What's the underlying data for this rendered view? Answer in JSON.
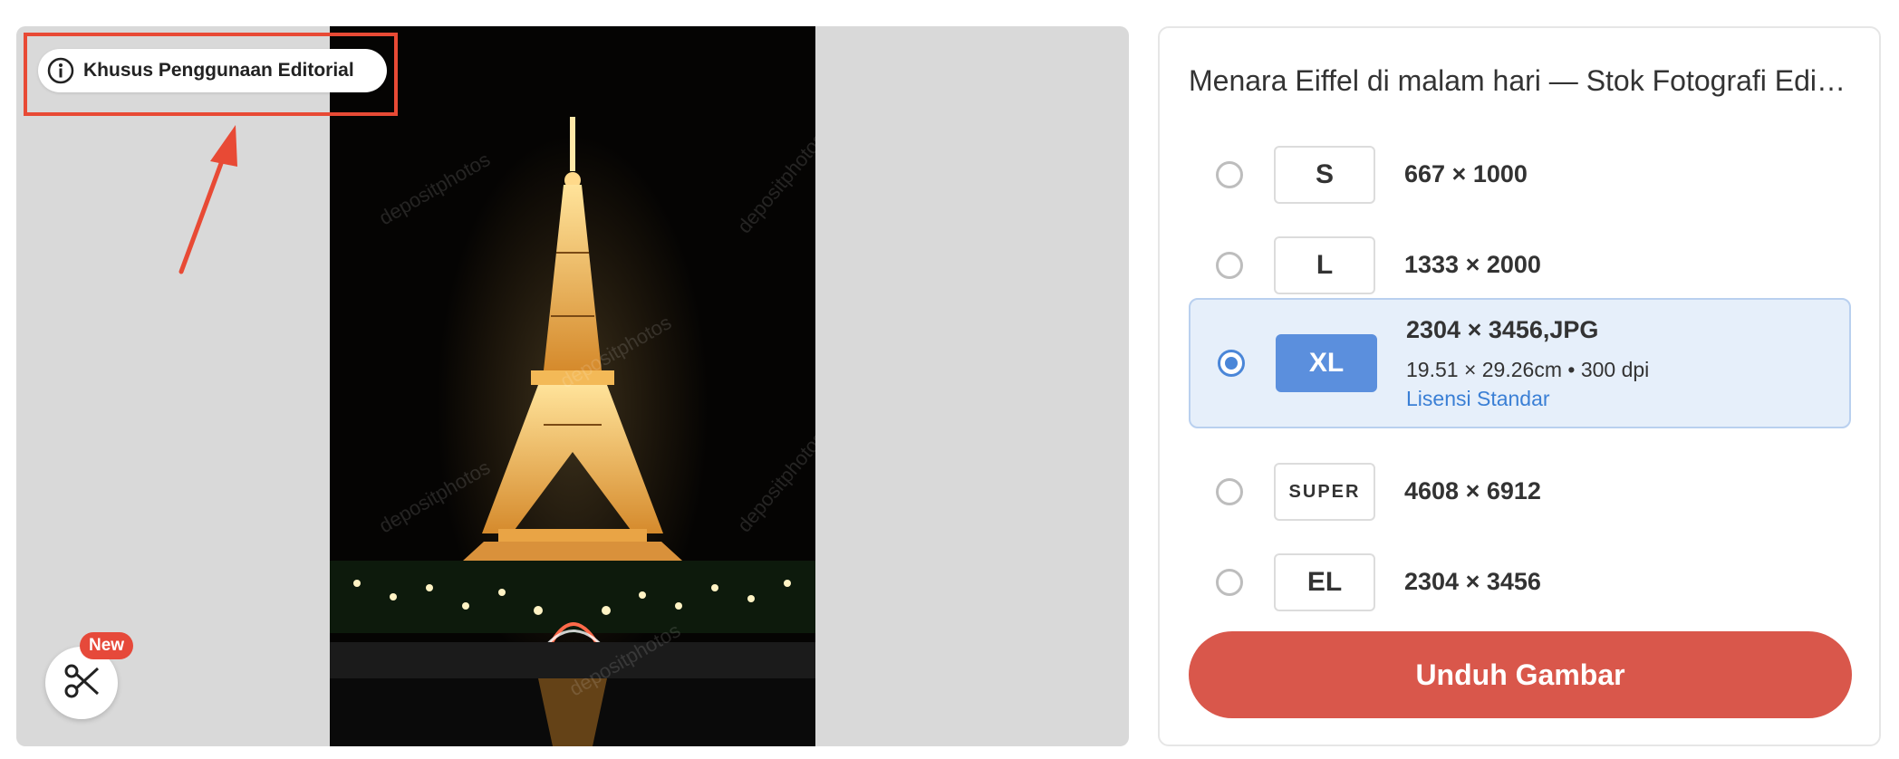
{
  "viewer": {
    "editorial_badge": "Khusus Penggunaan Editorial",
    "new_badge": "New",
    "watermark": "depositphotos"
  },
  "panel": {
    "title": "Menara Eiffel di malam hari — Stok Fotografi Editorial",
    "options": [
      {
        "tag": "S",
        "dims": "667 × 1000"
      },
      {
        "tag": "L",
        "dims": "1333 × 2000"
      },
      {
        "tag": "XL",
        "dims": "2304 × 3456,JPG",
        "print_size": "19.51 × 29.26cm • 300 dpi",
        "license": "Lisensi Standar"
      },
      {
        "tag": "SUPER",
        "dims": "4608 × 6912"
      },
      {
        "tag": "EL",
        "dims": "2304 × 3456"
      }
    ],
    "selected": "XL",
    "download_label": "Unduh Gambar"
  },
  "colors": {
    "accent_red": "#d9574b",
    "selected_blue": "#5b8fdd",
    "highlight_red": "#e84a35"
  }
}
